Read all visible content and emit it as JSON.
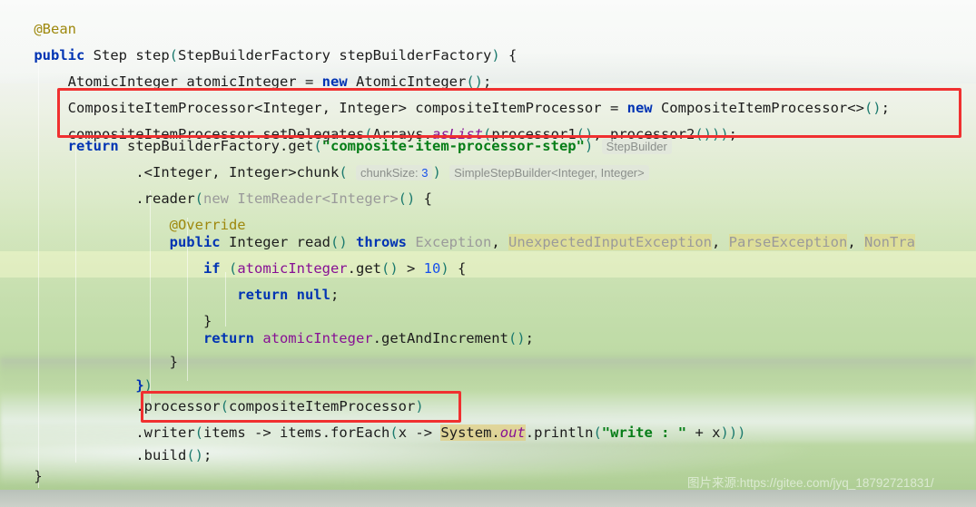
{
  "app": {
    "kind": "code-editor",
    "language": "Java",
    "accent_red": "#f03030",
    "keyword_color": "#0033b3",
    "string_color": "#067d17",
    "annotation_color": "#9e880d",
    "field_color": "#871094",
    "number_color": "#1750eb",
    "inlay_hint_color": "#8b8f8b"
  },
  "watermark": {
    "text": "图片来源:https://gitee.com/jyq_18792721831/"
  },
  "inlay_hints": {
    "step_builder": "StepBuilder",
    "chunk_size_label": "chunkSize:",
    "chunk_size_value": "3",
    "simple_step_builder": "SimpleStepBuilder<Integer, Integer>"
  },
  "annotations": [
    {
      "name": "composite-processor-declaration-box",
      "label": "red highlight box around CompositeItemProcessor declaration and setDelegates call"
    },
    {
      "name": "processor-call-box",
      "label": "red highlight box around .processor(compositeItemProcessor)"
    }
  ],
  "code": {
    "lines": [
      {
        "n": 1,
        "indent": 0,
        "text": "@Bean"
      },
      {
        "n": 2,
        "indent": 0,
        "text": "public Step step(StepBuilderFactory stepBuilderFactory) {"
      },
      {
        "n": 3,
        "indent": 1,
        "text": "AtomicInteger atomicInteger = new AtomicInteger();"
      },
      {
        "n": 4,
        "indent": 1,
        "text": "CompositeItemProcessor<Integer, Integer> compositeItemProcessor = new CompositeItemProcessor<>();"
      },
      {
        "n": 5,
        "indent": 1,
        "text": "compositeItemProcessor.setDelegates(Arrays.asList(processor1(), processor2()));"
      },
      {
        "n": 6,
        "indent": 1,
        "text": "return stepBuilderFactory.get(\"composite-item-processor-step\")"
      },
      {
        "n": 7,
        "indent": 3,
        "text": ".<Integer, Integer>chunk( 3)"
      },
      {
        "n": 8,
        "indent": 3,
        "text": ".reader(new ItemReader<Integer>() {"
      },
      {
        "n": 9,
        "indent": 4,
        "text": "@Override"
      },
      {
        "n": 10,
        "indent": 4,
        "text": "public Integer read() throws Exception, UnexpectedInputException, ParseException, NonTra"
      },
      {
        "n": 11,
        "indent": 5,
        "text": "if (atomicInteger.get() > 10) {"
      },
      {
        "n": 12,
        "indent": 6,
        "text": "return null;"
      },
      {
        "n": 13,
        "indent": 5,
        "text": "}"
      },
      {
        "n": 14,
        "indent": 5,
        "text": "return atomicInteger.getAndIncrement();"
      },
      {
        "n": 15,
        "indent": 4,
        "text": "}"
      },
      {
        "n": 16,
        "indent": 3,
        "text": "})"
      },
      {
        "n": 17,
        "indent": 3,
        "text": ".processor(compositeItemProcessor)"
      },
      {
        "n": 18,
        "indent": 3,
        "text": ".writer(items -> items.forEach(x -> System.out.println(\"write : \" + x)))"
      },
      {
        "n": 19,
        "indent": 3,
        "text": ".build();"
      },
      {
        "n": 20,
        "indent": 0,
        "text": "}"
      }
    ],
    "tokens": {
      "bean_annotation": "@Bean",
      "override_annotation": "@Override",
      "kw_public": "public",
      "kw_new": "new",
      "kw_return": "return",
      "kw_throws": "throws",
      "kw_if": "if",
      "kw_null": "null",
      "type_step": "Step",
      "method_step": "step",
      "type_step_builder_factory": "StepBuilderFactory",
      "var_step_builder_factory": "stepBuilderFactory",
      "type_atomic_integer": "AtomicInteger",
      "var_atomic_integer": "atomicInteger",
      "type_composite_item_processor": "CompositeItemProcessor",
      "var_composite_item_processor": "compositeItemProcessor",
      "generic_integer_integer": "<Integer, Integer>",
      "diamond": "<>",
      "method_set_delegates": "setDelegates",
      "type_arrays": "Arrays",
      "method_as_list": "asList",
      "method_processor1": "processor1",
      "method_processor2": "processor2",
      "method_get": "get",
      "string_step_name": "\"composite-item-processor-step\"",
      "method_chunk": "chunk",
      "method_reader": "reader",
      "type_item_reader": "ItemReader<Integer>",
      "type_integer": "Integer",
      "method_read": "read",
      "ex_exception": "Exception",
      "ex_unexpected_input": "UnexpectedInputException",
      "ex_parse": "ParseException",
      "ex_non_transient": "NonTra",
      "method_get_call": "get",
      "num_ten": "10",
      "method_get_and_increment": "getAndIncrement",
      "method_processor": "processor",
      "method_writer": "writer",
      "var_items": "items",
      "arrow": "->",
      "method_for_each": "forEach",
      "var_x": "x",
      "type_system": "System",
      "field_out": "out",
      "method_println": "println",
      "string_write": "\"write : \"",
      "plus": "+",
      "method_build": "build"
    }
  }
}
